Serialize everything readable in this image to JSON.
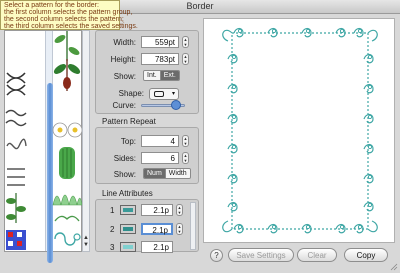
{
  "window": {
    "title": "Border"
  },
  "tooltip": {
    "lines": [
      "Select a pattern for the border:",
      "the first column selects the pattern group,",
      "the second column selects the pattern;",
      "the third column selects the saved settings."
    ]
  },
  "size": {
    "width_label": "Width:",
    "width_value": "559pt",
    "height_label": "Height:",
    "height_value": "783pt",
    "show_label": "Show:",
    "show_options": [
      "Int.",
      "Ext."
    ],
    "show_selected": "Ext.",
    "shape_label": "Shape:",
    "curve_label": "Curve:",
    "curve_level": 0.8
  },
  "pattern_repeat": {
    "title": "Pattern Repeat",
    "top_label": "Top:",
    "top_value": "4",
    "sides_label": "Sides:",
    "sides_value": "6",
    "show_label": "Show:",
    "show_options": [
      "Num",
      "Width"
    ],
    "show_selected": "Num"
  },
  "line_attributes": {
    "title": "Line Attributes",
    "lines": [
      {
        "num": "1",
        "value": "2.1p",
        "color": "#3a9a98"
      },
      {
        "num": "2",
        "value": "2.1p",
        "color": "#2f8f8c"
      },
      {
        "num": "3",
        "value": "2.1p",
        "color": "#7fd0cf"
      }
    ]
  },
  "buttons": {
    "help": "?",
    "save_settings": "Save Settings",
    "clear": "Clear",
    "copy": "Copy"
  },
  "colors": {
    "border_motif": "#3fa7a5",
    "selection_blue": "#5a8ed4"
  }
}
